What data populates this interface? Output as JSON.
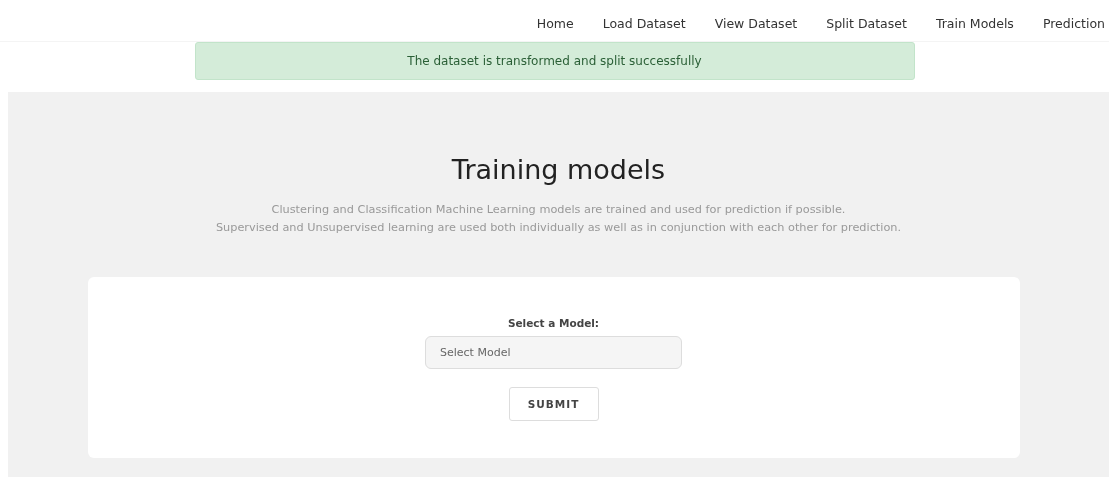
{
  "nav": {
    "items": [
      {
        "label": "Home"
      },
      {
        "label": "Load Dataset"
      },
      {
        "label": "View Dataset"
      },
      {
        "label": "Split Dataset"
      },
      {
        "label": "Train Models"
      },
      {
        "label": "Prediction"
      }
    ]
  },
  "alert": {
    "kind": "success",
    "text": "The dataset is transformed and split successfully"
  },
  "hero": {
    "title": "Training models",
    "lines": [
      "Clustering and Classification Machine Learning models are trained and used for prediction if possible.",
      "Supervised and Unsupervised learning are used both individually as well as in conjunction with each other for prediction."
    ]
  },
  "form": {
    "label": "Select a Model:",
    "select": {
      "placeholder": "Select Model"
    },
    "button": "SUBMIT"
  }
}
